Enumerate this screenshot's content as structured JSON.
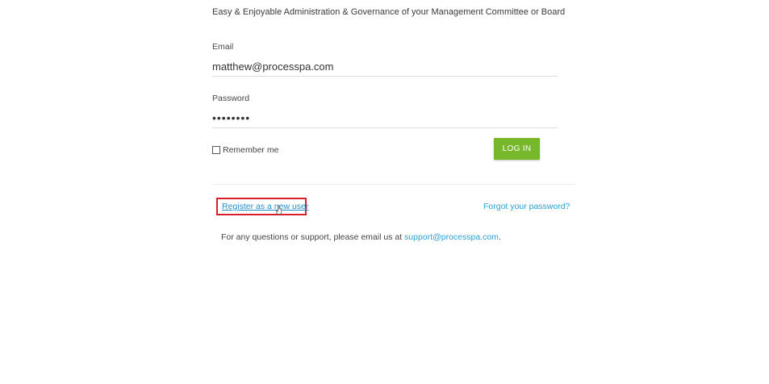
{
  "header": {
    "tagline": "Easy & Enjoyable Administration & Governance of your Management Committee or Board"
  },
  "form": {
    "email_label": "Email",
    "email_value": "matthew@processpa.com",
    "password_label": "Password",
    "password_value": "••••••••",
    "remember_label": "Remember me",
    "remember_checked": false,
    "login_label": "LOG IN"
  },
  "links": {
    "register": "Register as a new user",
    "forgot": "Forgot your password?"
  },
  "support": {
    "text": "For any questions or support, please email us at",
    "email": "support@processpa.com",
    "trailing": "."
  },
  "colors": {
    "accent_green": "#76b82a",
    "link_blue": "#2a9fd6",
    "highlight_red": "#d61f2c"
  }
}
